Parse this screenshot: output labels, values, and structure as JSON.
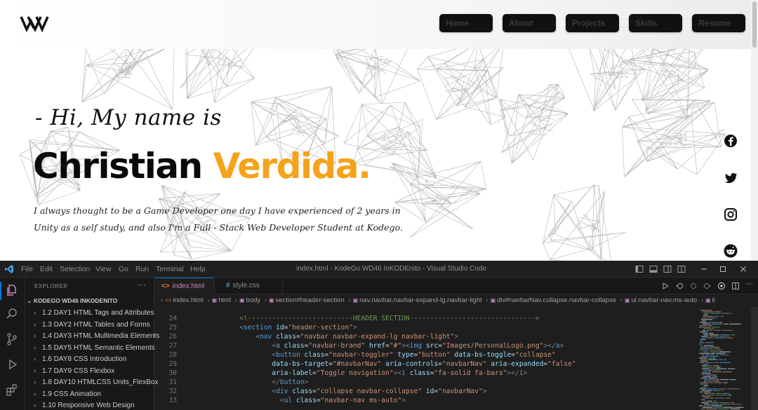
{
  "site": {
    "nav": {
      "home": "Home",
      "about": "About",
      "projects": "Projects",
      "skills": "Skills",
      "resume": "Resume"
    },
    "hero": {
      "greeting": "- Hi, My name is",
      "first_name": "Christian",
      "last_name": "Verdida.",
      "intro_line1": "I always thought to be a Game Developer one day I have experienced of 2 years in",
      "intro_line2": "Unity as a self study, and also I'm a Full - Stack Web Developer Student at Kodego."
    },
    "colors": {
      "accent": "#f5a31a",
      "text": "#0a0a0a",
      "nav_button": "#111111"
    },
    "social_icons": [
      "facebook-icon",
      "twitter-icon",
      "instagram-icon",
      "reddit-icon"
    ]
  },
  "vscode": {
    "menu": [
      "File",
      "Edit",
      "Selection",
      "View",
      "Go",
      "Run",
      "Terminal",
      "Help"
    ],
    "window_title": "index.html - KodeGo WD46 InKODEnito - Visual Studio Code",
    "explorer": {
      "title": "EXPLORER",
      "more": "···",
      "workspace": "KODEGO WD46 INKODENITO",
      "folders": [
        "1.2 DAY1 HTML Tags and Attributes",
        "1.3 DAY2 HTML Tables and Forms",
        "1.4 DAY3 HTML Multimedia Elements",
        "1.5 DAY5 HTML Semantic Elements",
        "1.6 DAY8 CSS Introduction",
        "1.7 DAY9 CSS Flexbox",
        "1.8 DAY10 HTMLCSS Units_FlexBox",
        "1.9 CSS Animation",
        "1.10 Responsive Web Design"
      ]
    },
    "tabs": [
      {
        "label": "index.html",
        "icon": "<>"
      },
      {
        "label": "style.css",
        "icon": "#"
      }
    ],
    "breadcrumb": [
      "index.html",
      "html",
      "body",
      "section#header-section",
      "nav.navbar.navbar-expand-lg.navbar-light",
      "div#navbarNav.collapse.navbar-collapse",
      "ul.navbar-nav.ms-auto",
      "li"
    ],
    "code_lines": [
      {
        "n": "24",
        "indent": "    ",
        "text": "<!--------------------------HEADER SECTION------------------------------->"
      },
      {
        "n": "25",
        "indent": "    ",
        "text": "<section id=\"header-section\">"
      },
      {
        "n": "26",
        "indent": "        ",
        "text": "<nav class=\"navbar navbar-expand-lg navbar-light\">"
      },
      {
        "n": "27",
        "indent": "            ",
        "text": "<a class=\"navbar-brand\" href=\"#\"><img src=\"Images/PersonalLogo.png\"></a>"
      },
      {
        "n": "28",
        "indent": "            ",
        "text": "<button class=\"navbar-toggler\" type=\"button\" data-bs-toggle=\"collapse\""
      },
      {
        "n": "29",
        "indent": "            ",
        "text": "data-bs-target=\"#navbarNav\" aria-controls=\"navbarNav\" aria-expanded=\"false\""
      },
      {
        "n": "30",
        "indent": "            ",
        "text": "aria-label=\"Toggle navigation\"><i class=\"fa-solid fa-bars\"></i>"
      },
      {
        "n": "31",
        "indent": "            ",
        "text": "</button>"
      },
      {
        "n": "32",
        "indent": "            ",
        "text": "<div class=\"collapse navbar-collapse\" id=\"navbarNav\">"
      },
      {
        "n": "33",
        "indent": "              ",
        "text": "<ul class=\"navbar-nav ms-auto\">"
      }
    ],
    "colors": {
      "editor_bg": "#1e1e1e",
      "sidebar_bg": "#181818",
      "accent": "#0078d4"
    }
  }
}
